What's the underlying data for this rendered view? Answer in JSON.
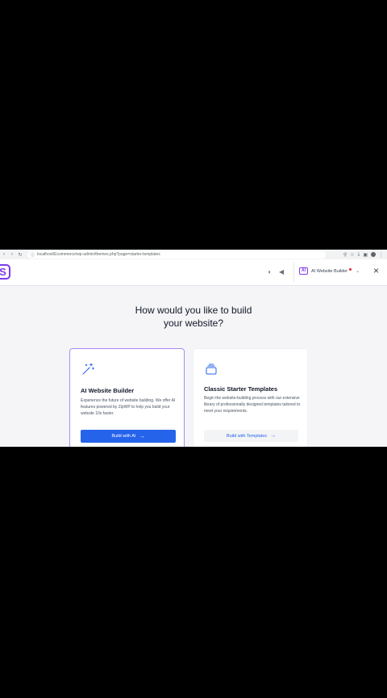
{
  "browser": {
    "url": "localhost/Ecommerce/wp-admin/themes.php?page=starter-templates",
    "back_glyph": "‹",
    "forward_glyph": "›",
    "reload_glyph": "↻",
    "lock_glyph": "ⓘ"
  },
  "header": {
    "logo_letter": "S",
    "builder_tag": "AI",
    "builder_label": "AI Website Builder",
    "chevron": "⌄",
    "close_glyph": "×"
  },
  "main": {
    "heading_line1": "How would you like to build",
    "heading_line2": "your website?"
  },
  "cards": {
    "ai": {
      "title": "AI Website Builder",
      "description": "Experience the future of website building. We offer AI features powered by ZipWP to help you build your website 10x faster.",
      "button_label": "Build with AI",
      "arrow": "→"
    },
    "classic": {
      "title": "Classic Starter Templates",
      "description": "Begin the website-building process with our extensive library of professionally designed templates tailored to meet your requirements.",
      "button_label": "Build with Templates",
      "arrow": "→"
    }
  },
  "colors": {
    "accent": "#7c3aed",
    "primary": "#2563eb",
    "notification": "#dc2626"
  }
}
